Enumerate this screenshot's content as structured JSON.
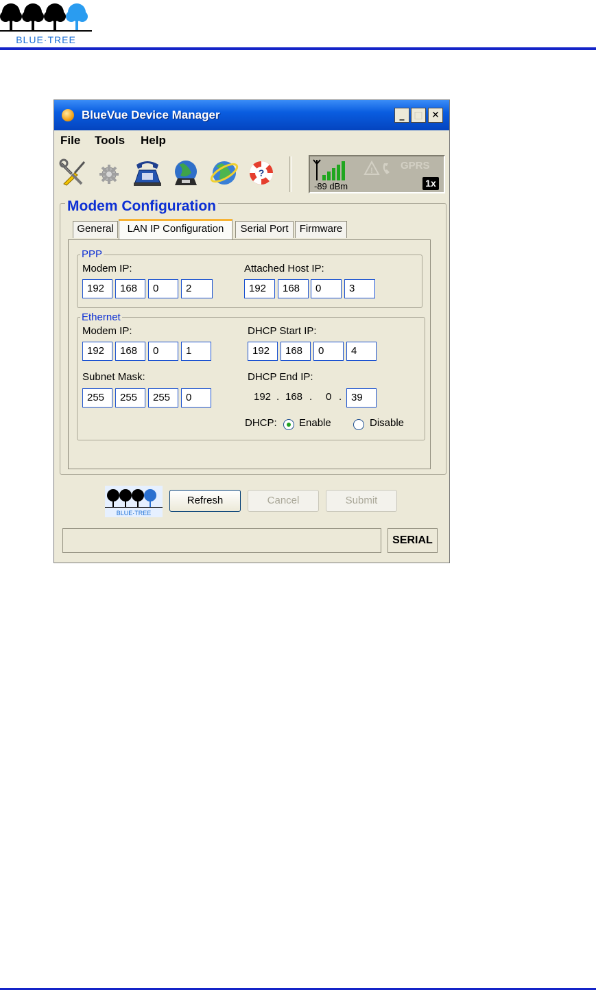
{
  "page": {
    "logo_text": "BLUE·TREE"
  },
  "window": {
    "title": "BlueVue Device Manager",
    "min_glyph": "_",
    "max_glyph": "□",
    "close_glyph": "✕"
  },
  "menu": {
    "items": [
      "File",
      "Tools",
      "Help"
    ]
  },
  "toolbar": {
    "icons": [
      "wrench-screwdriver-icon",
      "gear-icon",
      "telephone-icon",
      "globe-phone-icon",
      "globe-icon",
      "lifebuoy-help-icon"
    ]
  },
  "signal": {
    "strength": "-89 dBm",
    "network": "GPRS",
    "mode": "1x"
  },
  "section": {
    "title": "Modem Configuration"
  },
  "tabs": [
    {
      "label": "General"
    },
    {
      "label": "LAN IP Configuration"
    },
    {
      "label": "Serial Port"
    },
    {
      "label": "Firmware"
    }
  ],
  "ppp": {
    "legend": "PPP",
    "modem_ip_label": "Modem IP:",
    "modem_ip": [
      "192",
      "168",
      "0",
      "2"
    ],
    "host_ip_label": "Attached Host IP:",
    "host_ip": [
      "192",
      "168",
      "0",
      "3"
    ]
  },
  "ethernet": {
    "legend": "Ethernet",
    "modem_ip_label": "Modem IP:",
    "modem_ip": [
      "192",
      "168",
      "0",
      "1"
    ],
    "subnet_label": "Subnet Mask:",
    "subnet": [
      "255",
      "255",
      "255",
      "0"
    ],
    "dhcp_start_label": "DHCP Start IP:",
    "dhcp_start": [
      "192",
      "168",
      "0",
      "4"
    ],
    "dhcp_end_label": "DHCP End IP:",
    "dhcp_end_fixed": [
      "192",
      "168",
      "0"
    ],
    "dot": ".",
    "dhcp_end_last": "39",
    "dhcp_label": "DHCP:",
    "enable_label": "Enable",
    "disable_label": "Disable",
    "dhcp_selected": "Enable"
  },
  "buttons": {
    "refresh": "Refresh",
    "cancel": "Cancel",
    "submit": "Submit",
    "logo_text": "BLUE·TREE"
  },
  "status": {
    "message": "",
    "connection": "SERIAL"
  }
}
